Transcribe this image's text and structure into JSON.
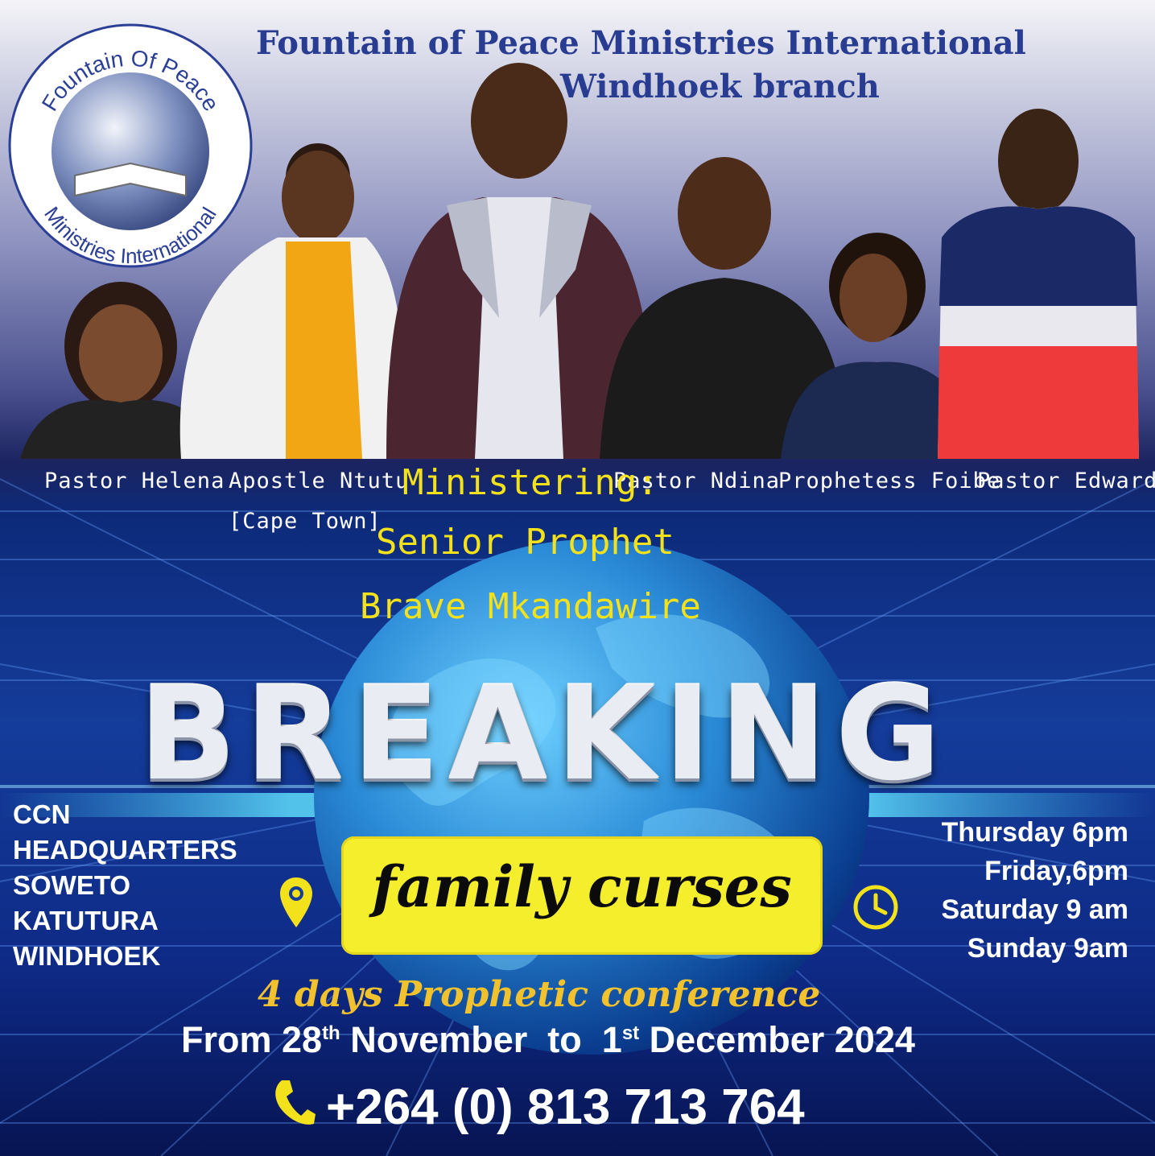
{
  "header": {
    "line1": "Fountain of Peace Ministries International",
    "line2": "Windhoek branch"
  },
  "logo": {
    "top_text": "Fountain Of Peace",
    "bottom_text": "Ministries International"
  },
  "captions": {
    "helena": "Pastor Helena",
    "ntutu": "Apostle Ntutu",
    "ntutu_sub": "[Cape Town]",
    "ndina": "Pastor Ndina",
    "foibe": "Prophetess Foibe",
    "edward": "Pastor Edward"
  },
  "ministering": {
    "label": "Ministering:",
    "line1": "Senior Prophet",
    "line2": "Brave Mkandawire"
  },
  "title": "BREAKING",
  "subtitle": "family curses",
  "location": [
    "CCN",
    "HEADQUARTERS",
    "SOWETO",
    "KATUTURA",
    "WINDHOEK"
  ],
  "schedule": [
    "Thursday 6pm",
    "Friday,6pm",
    "Saturday 9 am",
    "Sunday 9am"
  ],
  "conference": "4 days Prophetic conference",
  "dates": {
    "from": "From 28",
    "sup1": "th",
    "mid": " November  to  1",
    "sup2": "st",
    "end": " December 2024"
  },
  "phone": "+264 (0) 813 713 764",
  "colors": {
    "header_blue": "#283d91",
    "accent_yellow": "#f3e21b",
    "box_yellow": "#f5ee2c",
    "conference_gold": "#f2c12e"
  },
  "icons": [
    "location-pin-icon",
    "clock-icon",
    "phone-icon"
  ]
}
